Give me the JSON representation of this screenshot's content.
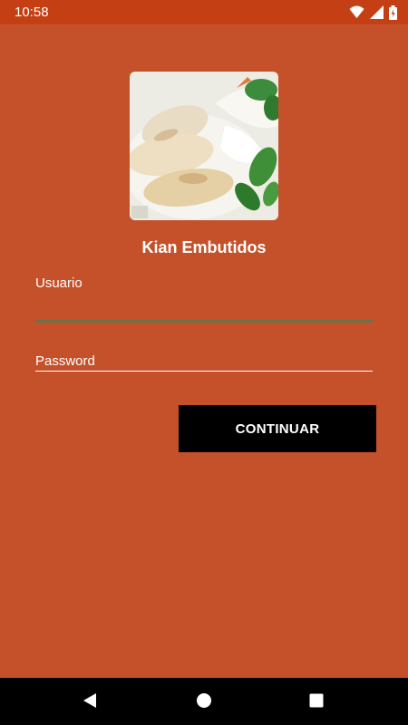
{
  "status_bar": {
    "time": "10:58",
    "icons": [
      "wifi-icon",
      "signal-icon",
      "battery-icon"
    ]
  },
  "app": {
    "title": "Kian Embutidos",
    "logo": "chicken-dish-photo"
  },
  "form": {
    "username_label": "Usuario",
    "username_value": "",
    "password_placeholder": "Password",
    "continue_label": "CONTINUAR"
  },
  "nav_bar": {
    "buttons": [
      "back-icon",
      "home-icon",
      "recents-icon"
    ]
  },
  "colors": {
    "status_bar": "#c43f14",
    "background": "#c4512a",
    "button": "#000000",
    "username_underline": "#6f6f4a"
  }
}
